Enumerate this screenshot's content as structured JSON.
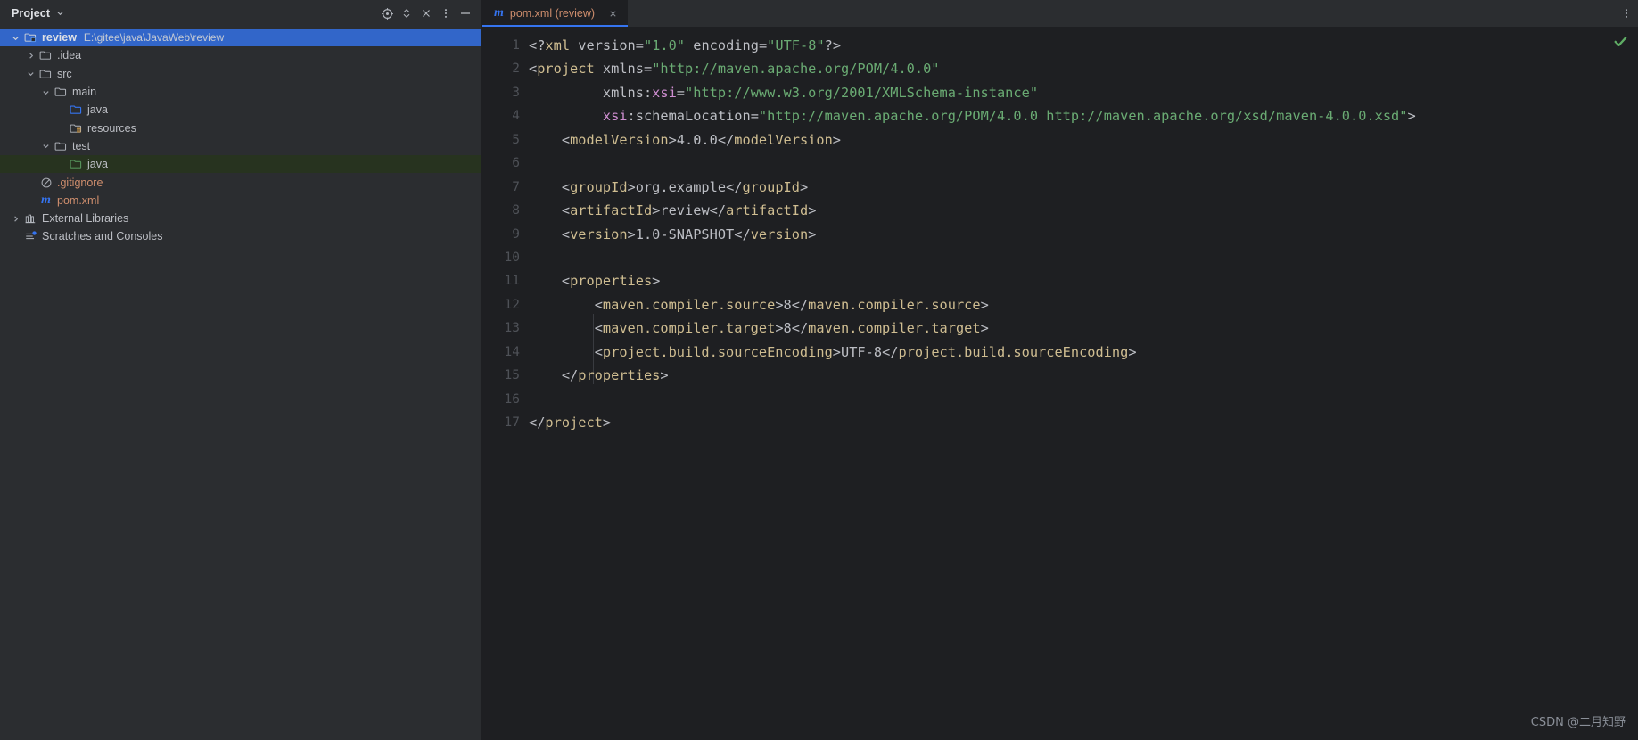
{
  "project_panel": {
    "title": "Project",
    "title_chevron_icon": "chevron-down-icon",
    "toolbar": [
      {
        "name": "select-opened-file-icon",
        "icon": "target-crosshair-icon"
      },
      {
        "name": "expand-collapse-icon",
        "icon": "chevron-up-down-icon"
      },
      {
        "name": "collapse-all-icon",
        "icon": "close-x-icon"
      },
      {
        "name": "options-icon",
        "icon": "kebab-menu-icon"
      },
      {
        "name": "hide-icon",
        "icon": "minimize-line-icon"
      }
    ],
    "tree": [
      {
        "label": "review",
        "path": "E:\\gitee\\java\\JavaWeb\\review",
        "icon": "project-folder-icon",
        "indent": 0,
        "twisty": "expanded",
        "state": "selected",
        "bold": true
      },
      {
        "label": ".idea",
        "path": "",
        "icon": "folder-icon",
        "indent": 1,
        "twisty": "collapsed",
        "state": "normal",
        "bold": false
      },
      {
        "label": "src",
        "path": "",
        "icon": "folder-icon",
        "indent": 1,
        "twisty": "expanded",
        "state": "normal",
        "bold": false
      },
      {
        "label": "main",
        "path": "",
        "icon": "folder-icon",
        "indent": 2,
        "twisty": "expanded",
        "state": "normal",
        "bold": false
      },
      {
        "label": "java",
        "path": "",
        "icon": "sources-root-folder-icon",
        "indent": 3,
        "twisty": "none",
        "state": "normal",
        "bold": false
      },
      {
        "label": "resources",
        "path": "",
        "icon": "resources-root-folder-icon",
        "indent": 3,
        "twisty": "none",
        "state": "normal",
        "bold": false
      },
      {
        "label": "test",
        "path": "",
        "icon": "folder-icon",
        "indent": 2,
        "twisty": "expanded",
        "state": "normal",
        "bold": false
      },
      {
        "label": "java",
        "path": "",
        "icon": "test-sources-root-folder-icon",
        "indent": 3,
        "twisty": "none",
        "state": "testroot",
        "bold": false
      },
      {
        "label": ".gitignore",
        "path": "",
        "icon": "gitignore-icon",
        "indent": 1,
        "twisty": "none",
        "state": "normal",
        "bold": false,
        "color": "vcs-orange"
      },
      {
        "label": "pom.xml",
        "path": "",
        "icon": "maven-m-icon",
        "indent": 1,
        "twisty": "none",
        "state": "normal",
        "bold": false,
        "color": "vcs-orange"
      },
      {
        "label": "External Libraries",
        "path": "",
        "icon": "libraries-icon",
        "indent": 0,
        "twisty": "collapsed",
        "state": "normal",
        "bold": false
      },
      {
        "label": "Scratches and Consoles",
        "path": "",
        "icon": "scratches-icon",
        "indent": 0,
        "twisty": "none",
        "state": "normal",
        "bold": false
      }
    ]
  },
  "editor": {
    "tab": {
      "label": "pom.xml (review)",
      "file_icon": "maven-m-icon",
      "close_icon": "close-x-icon"
    },
    "tabbar_options_icon": "kebab-menu-icon",
    "inspection_status_icon": "green-checkmark-icon",
    "line_numbers": [
      1,
      2,
      3,
      4,
      5,
      6,
      7,
      8,
      9,
      10,
      11,
      12,
      13,
      14,
      15,
      16,
      17
    ],
    "code": [
      {
        "n": 1,
        "text": "<?xml version=\"1.0\" encoding=\"UTF-8\"?>"
      },
      {
        "n": 2,
        "text": "<project xmlns=\"http://maven.apache.org/POM/4.0.0\""
      },
      {
        "n": 3,
        "text": "         xmlns:xsi=\"http://www.w3.org/2001/XMLSchema-instance\""
      },
      {
        "n": 4,
        "text": "         xsi:schemaLocation=\"http://maven.apache.org/POM/4.0.0 http://maven.apache.org/xsd/maven-4.0.0.xsd\">"
      },
      {
        "n": 5,
        "text": "    <modelVersion>4.0.0</modelVersion>"
      },
      {
        "n": 6,
        "text": ""
      },
      {
        "n": 7,
        "text": "    <groupId>org.example</groupId>"
      },
      {
        "n": 8,
        "text": "    <artifactId>review</artifactId>"
      },
      {
        "n": 9,
        "text": "    <version>1.0-SNAPSHOT</version>"
      },
      {
        "n": 10,
        "text": ""
      },
      {
        "n": 11,
        "text": "    <properties>"
      },
      {
        "n": 12,
        "text": "        <maven.compiler.source>8</maven.compiler.source>"
      },
      {
        "n": 13,
        "text": "        <maven.compiler.target>8</maven.compiler.target>"
      },
      {
        "n": 14,
        "text": "        <project.build.sourceEncoding>UTF-8</project.build.sourceEncoding>"
      },
      {
        "n": 15,
        "text": "    </properties>"
      },
      {
        "n": 16,
        "text": ""
      },
      {
        "n": 17,
        "text": "</project>"
      }
    ]
  },
  "watermark": "CSDN @二月知野",
  "colors": {
    "accent": "#3574f0",
    "panel_bg": "#2b2d30",
    "editor_bg": "#1e1f22",
    "selection": "#3574f0",
    "test_root": "#27331f",
    "tag": "#cfbd91",
    "string": "#6aab73",
    "namespace": "#cf8ed1",
    "text": "#bcbec4",
    "vcs_orange": "#cf8e6d",
    "line_number": "#4e5157",
    "ok_green": "#5fad65"
  }
}
